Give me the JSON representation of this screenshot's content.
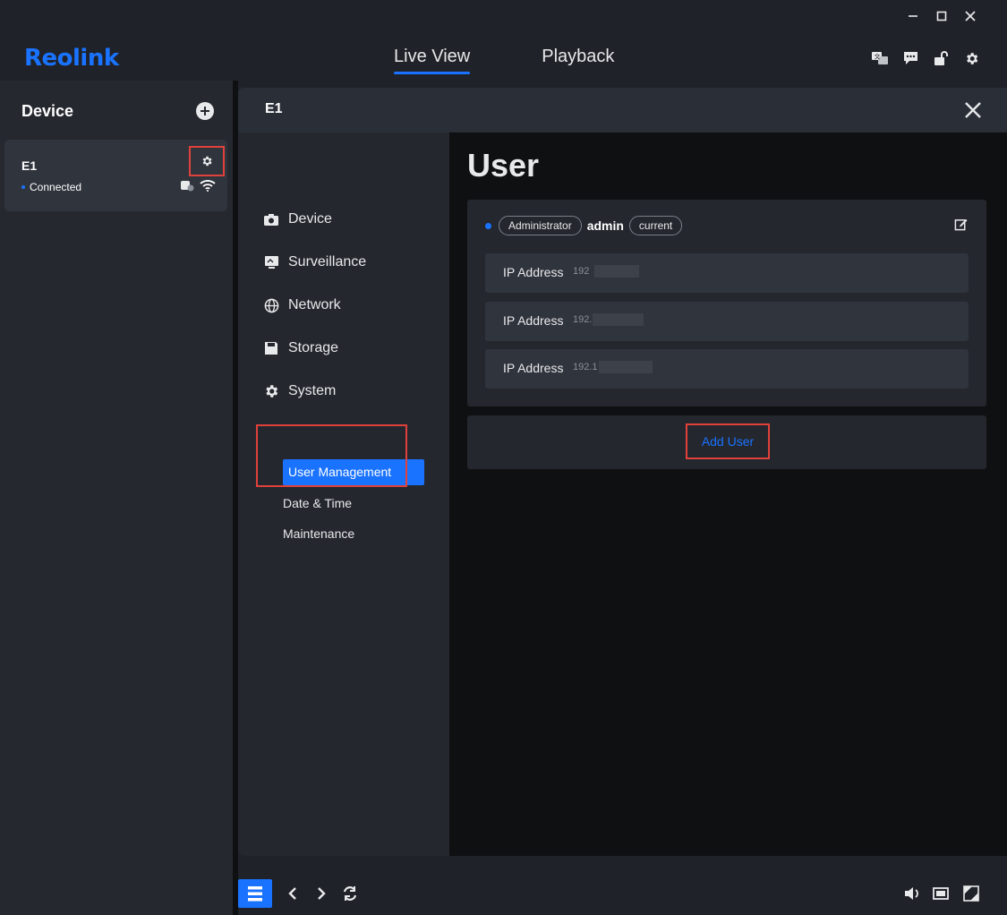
{
  "app": {
    "logo": "Reolink"
  },
  "window_controls": {
    "minimize": "—",
    "maximize": "☐",
    "close": "✕"
  },
  "nav_tabs": [
    {
      "label": "Live View",
      "active": true
    },
    {
      "label": "Playback",
      "active": false
    }
  ],
  "top_icons": [
    "translate-icon",
    "chat-icon",
    "unlock-icon",
    "settings-icon"
  ],
  "device_panel": {
    "title": "Device",
    "device": {
      "name": "E1",
      "status": "Connected"
    }
  },
  "modal": {
    "title": "E1",
    "nav": [
      {
        "label": "Device",
        "icon": "camera-icon"
      },
      {
        "label": "Surveillance",
        "icon": "monitor-icon"
      },
      {
        "label": "Network",
        "icon": "globe-icon"
      },
      {
        "label": "Storage",
        "icon": "floppy-icon"
      },
      {
        "label": "System",
        "icon": "gear-icon"
      }
    ],
    "sub_nav": [
      {
        "label": "User Management",
        "active": true
      },
      {
        "label": "Date & Time",
        "active": false
      },
      {
        "label": "Maintenance",
        "active": false
      }
    ],
    "content": {
      "title": "User",
      "user": {
        "role": "Administrator",
        "name": "admin",
        "tag": "current"
      },
      "ip_rows": [
        {
          "label": "IP Address",
          "value": "192"
        },
        {
          "label": "IP Address",
          "value": "192."
        },
        {
          "label": "IP Address",
          "value": "192.1"
        }
      ],
      "add_button": "Add User"
    }
  },
  "colors": {
    "accent": "#1a73ff",
    "highlight": "#e0413a",
    "panel": "#24272e",
    "background": "#0f1012"
  }
}
